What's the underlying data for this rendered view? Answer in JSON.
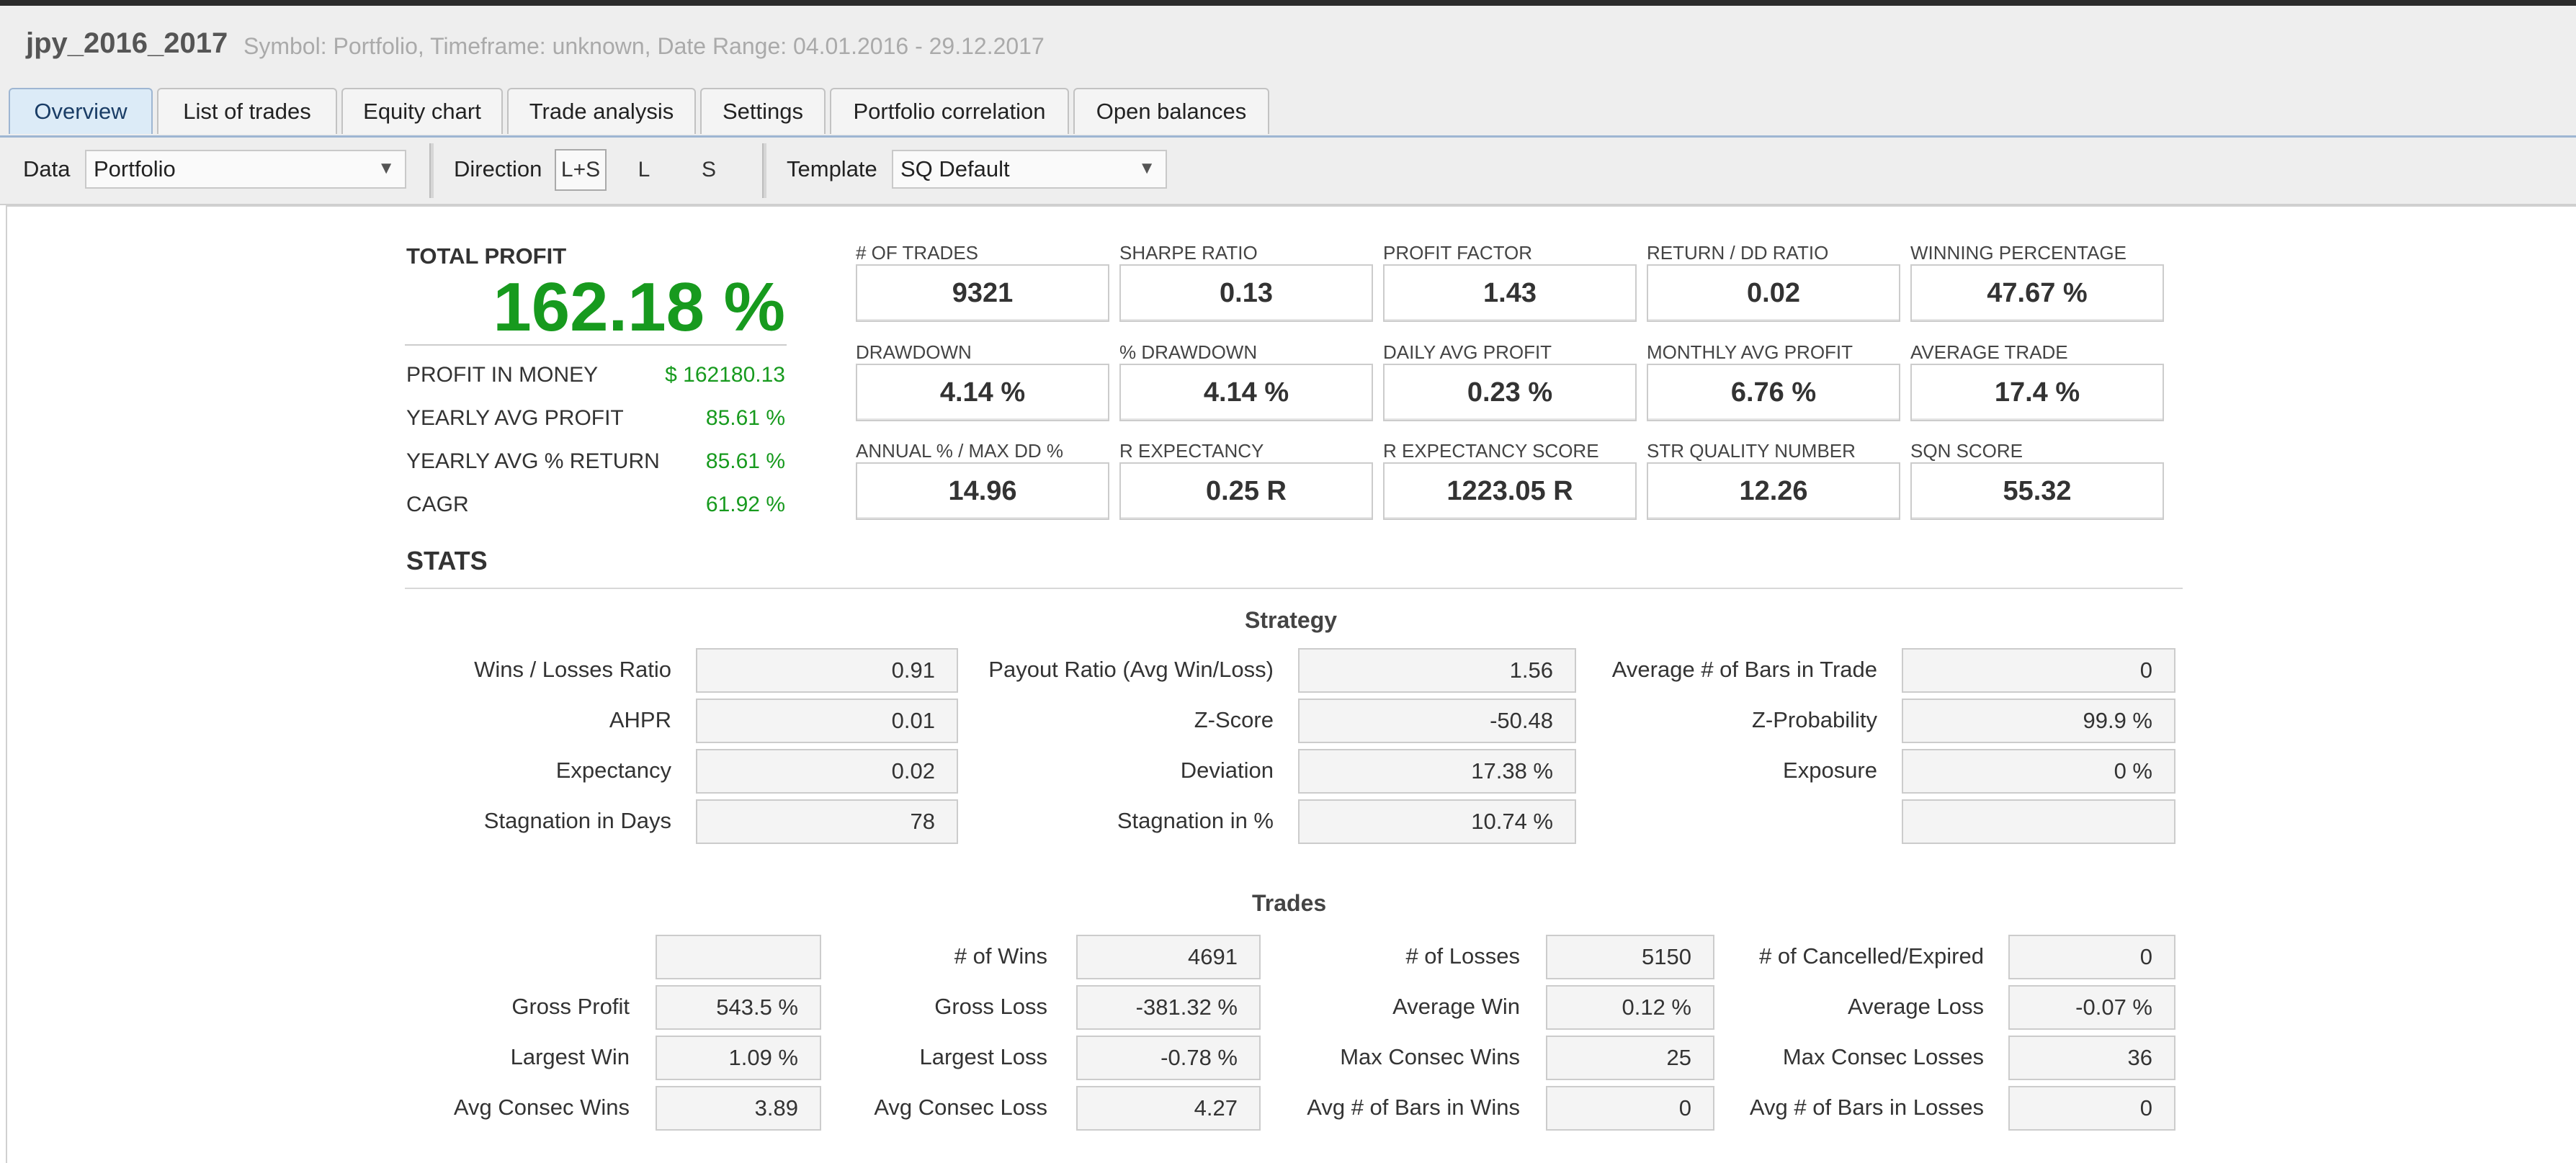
{
  "window": {
    "title": "jpy_2016_2017",
    "info": "Symbol: Portfolio, Timeframe: unknown, Date Range: 04.01.2016 - 29.12.2017"
  },
  "tabs": [
    {
      "label": "Overview",
      "active": true
    },
    {
      "label": "List of trades"
    },
    {
      "label": "Equity chart"
    },
    {
      "label": "Trade analysis"
    },
    {
      "label": "Settings"
    },
    {
      "label": "Portfolio correlation"
    },
    {
      "label": "Open balances"
    }
  ],
  "toolbar": {
    "data_label": "Data",
    "data_value": "Portfolio",
    "direction_label": "Direction",
    "directions": [
      "L+S",
      "L",
      "S"
    ],
    "direction_selected": "L+S",
    "template_label": "Template",
    "template_value": "SQ Default"
  },
  "summary": {
    "total_profit_label": "TOTAL PROFIT",
    "total_profit_value": "162.18 %",
    "rows": [
      {
        "label": "PROFIT IN MONEY",
        "value": "$ 162180.13"
      },
      {
        "label": "YEARLY AVG PROFIT",
        "value": "85.61 %"
      },
      {
        "label": "YEARLY AVG % RETURN",
        "value": "85.61 %"
      },
      {
        "label": "CAGR",
        "value": "61.92 %"
      }
    ]
  },
  "metrics": [
    {
      "label": "# OF TRADES",
      "value": "9321"
    },
    {
      "label": "SHARPE RATIO",
      "value": "0.13"
    },
    {
      "label": "PROFIT FACTOR",
      "value": "1.43"
    },
    {
      "label": "RETURN / DD RATIO",
      "value": "0.02"
    },
    {
      "label": "WINNING PERCENTAGE",
      "value": "47.67 %"
    },
    {
      "label": "DRAWDOWN",
      "value": "4.14 %"
    },
    {
      "label": "% DRAWDOWN",
      "value": "4.14 %"
    },
    {
      "label": "DAILY AVG PROFIT",
      "value": "0.23 %"
    },
    {
      "label": "MONTHLY AVG PROFIT",
      "value": "6.76 %"
    },
    {
      "label": "AVERAGE TRADE",
      "value": "17.4 %"
    },
    {
      "label": "ANNUAL % / MAX DD %",
      "value": "14.96"
    },
    {
      "label": "R EXPECTANCY",
      "value": "0.25 R"
    },
    {
      "label": "R EXPECTANCY SCORE",
      "value": "1223.05 R"
    },
    {
      "label": "STR QUALITY NUMBER",
      "value": "12.26"
    },
    {
      "label": "SQN SCORE",
      "value": "55.32"
    }
  ],
  "stats": {
    "title": "STATS",
    "strategy": {
      "title": "Strategy",
      "rows": [
        [
          {
            "label": "Wins / Losses Ratio",
            "value": "0.91"
          },
          {
            "label": "Payout Ratio (Avg Win/Loss)",
            "value": "1.56"
          },
          {
            "label": "Average # of Bars in Trade",
            "value": "0"
          }
        ],
        [
          {
            "label": "AHPR",
            "value": "0.01"
          },
          {
            "label": "Z-Score",
            "value": "-50.48"
          },
          {
            "label": "Z-Probability",
            "value": "99.9 %"
          }
        ],
        [
          {
            "label": "Expectancy",
            "value": "0.02"
          },
          {
            "label": "Deviation",
            "value": "17.38 %"
          },
          {
            "label": "Exposure",
            "value": "0 %"
          }
        ],
        [
          {
            "label": "Stagnation in Days",
            "value": "78"
          },
          {
            "label": "Stagnation in %",
            "value": "10.74 %"
          },
          {
            "label": "",
            "value": ""
          }
        ]
      ]
    },
    "trades": {
      "title": "Trades",
      "rows": [
        [
          {
            "label": "",
            "value": ""
          },
          {
            "label": "# of Wins",
            "value": "4691"
          },
          {
            "label": "# of Losses",
            "value": "5150"
          },
          {
            "label": "# of Cancelled/Expired",
            "value": "0"
          }
        ],
        [
          {
            "label": "Gross Profit",
            "value": "543.5 %"
          },
          {
            "label": "Gross Loss",
            "value": "-381.32 %"
          },
          {
            "label": "Average Win",
            "value": "0.12 %"
          },
          {
            "label": "Average Loss",
            "value": "-0.07 %"
          }
        ],
        [
          {
            "label": "Largest Win",
            "value": "1.09 %"
          },
          {
            "label": "Largest Loss",
            "value": "-0.78 %"
          },
          {
            "label": "Max Consec Wins",
            "value": "25"
          },
          {
            "label": "Max Consec Losses",
            "value": "36"
          }
        ],
        [
          {
            "label": "Avg Consec Wins",
            "value": "3.89"
          },
          {
            "label": "Avg Consec Loss",
            "value": "4.27"
          },
          {
            "label": "Avg # of Bars in Wins",
            "value": "0"
          },
          {
            "label": "Avg # of Bars in Losses",
            "value": "0"
          }
        ]
      ]
    }
  }
}
